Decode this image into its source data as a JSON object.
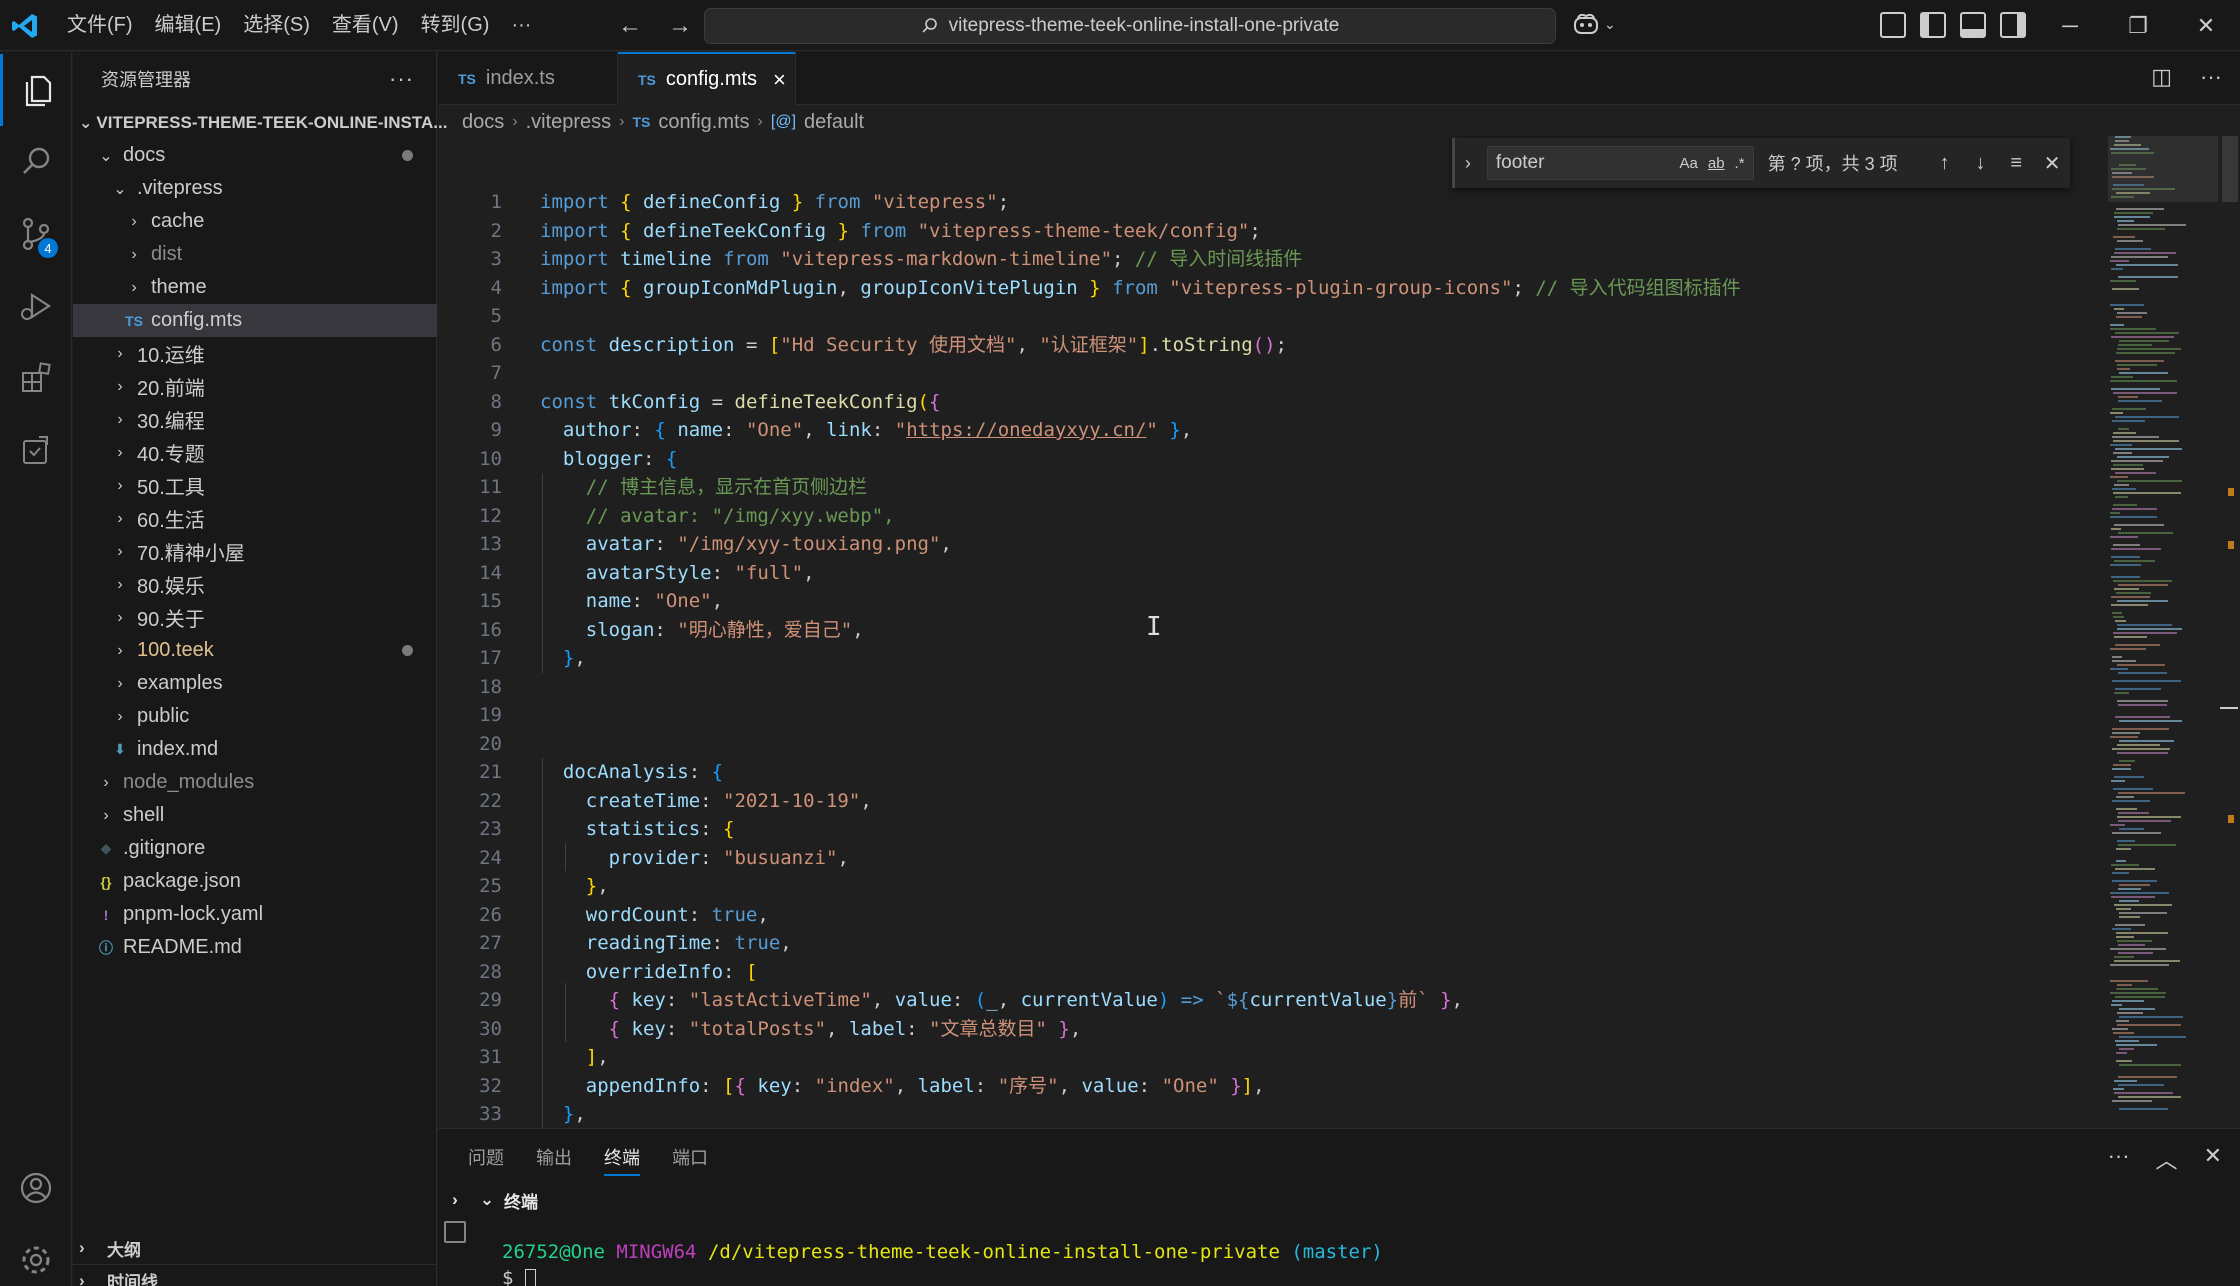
{
  "titlebar": {
    "menu": [
      "文件(F)",
      "编辑(E)",
      "选择(S)",
      "查看(V)",
      "转到(G)",
      "···"
    ],
    "search": "vitepress-theme-teek-online-install-one-private"
  },
  "activity": {
    "scm_badge": "4"
  },
  "sidebar": {
    "title": "资源管理器",
    "more": "···",
    "root": "VITEPRESS-THEME-TEEK-ONLINE-INSTA...",
    "tree": [
      {
        "label": "docs",
        "depth": 1,
        "type": "folder-open",
        "dot": true
      },
      {
        "label": ".vitepress",
        "depth": 2,
        "type": "folder-open"
      },
      {
        "label": "cache",
        "depth": 3,
        "type": "folder"
      },
      {
        "label": "dist",
        "depth": 3,
        "type": "folder",
        "dim": true
      },
      {
        "label": "theme",
        "depth": 3,
        "type": "folder"
      },
      {
        "label": "config.mts",
        "depth": 3,
        "type": "ts",
        "selected": true
      },
      {
        "label": "10.运维",
        "depth": 2,
        "type": "folder"
      },
      {
        "label": "20.前端",
        "depth": 2,
        "type": "folder"
      },
      {
        "label": "30.编程",
        "depth": 2,
        "type": "folder"
      },
      {
        "label": "40.专题",
        "depth": 2,
        "type": "folder"
      },
      {
        "label": "50.工具",
        "depth": 2,
        "type": "folder"
      },
      {
        "label": "60.生活",
        "depth": 2,
        "type": "folder"
      },
      {
        "label": "70.精神小屋",
        "depth": 2,
        "type": "folder"
      },
      {
        "label": "80.娱乐",
        "depth": 2,
        "type": "folder"
      },
      {
        "label": "90.关于",
        "depth": 2,
        "type": "folder"
      },
      {
        "label": "100.teek",
        "depth": 2,
        "type": "folder",
        "dot": true,
        "color": "#e2c08d"
      },
      {
        "label": "examples",
        "depth": 2,
        "type": "folder"
      },
      {
        "label": "public",
        "depth": 2,
        "type": "folder"
      },
      {
        "label": "index.md",
        "depth": 2,
        "type": "md"
      },
      {
        "label": "node_modules",
        "depth": 1,
        "type": "folder",
        "dim": true
      },
      {
        "label": "shell",
        "depth": 1,
        "type": "folder"
      },
      {
        "label": ".gitignore",
        "depth": 1,
        "type": "git"
      },
      {
        "label": "package.json",
        "depth": 1,
        "type": "json"
      },
      {
        "label": "pnpm-lock.yaml",
        "depth": 1,
        "type": "yaml"
      },
      {
        "label": "README.md",
        "depth": 1,
        "type": "info"
      }
    ],
    "outline": "大纲",
    "timeline": "时间线"
  },
  "tabs": [
    {
      "label": "index.ts",
      "lang": "TS",
      "active": false
    },
    {
      "label": "config.mts",
      "lang": "TS",
      "active": true
    }
  ],
  "breadcrumb": {
    "parts": [
      "docs",
      ".vitepress",
      "config.mts",
      "default"
    ],
    "ts": "TS",
    "sym": "[@]"
  },
  "find": {
    "query": "footer",
    "opts": [
      "Aa",
      "ab",
      ".*"
    ],
    "count": "第 ? 项，共 3 项"
  },
  "code": [
    {
      "n": "1",
      "seg": [
        [
          "k",
          "import"
        ],
        [
          "p",
          " "
        ],
        [
          "b1",
          "{"
        ],
        [
          "p",
          " "
        ],
        [
          "v",
          "defineConfig"
        ],
        [
          "p",
          " "
        ],
        [
          "b1",
          "}"
        ],
        [
          "p",
          " "
        ],
        [
          "k",
          "from"
        ],
        [
          "p",
          " "
        ],
        [
          "s",
          "\"vitepress\""
        ],
        [
          "p",
          ";"
        ]
      ]
    },
    {
      "n": "2",
      "seg": [
        [
          "k",
          "import"
        ],
        [
          "p",
          " "
        ],
        [
          "b1",
          "{"
        ],
        [
          "p",
          " "
        ],
        [
          "v",
          "defineTeekConfig"
        ],
        [
          "p",
          " "
        ],
        [
          "b1",
          "}"
        ],
        [
          "p",
          " "
        ],
        [
          "k",
          "from"
        ],
        [
          "p",
          " "
        ],
        [
          "s",
          "\"vitepress-theme-teek/config\""
        ],
        [
          "p",
          ";"
        ]
      ]
    },
    {
      "n": "3",
      "seg": [
        [
          "k",
          "import"
        ],
        [
          "p",
          " "
        ],
        [
          "v",
          "timeline"
        ],
        [
          "p",
          " "
        ],
        [
          "k",
          "from"
        ],
        [
          "p",
          " "
        ],
        [
          "s",
          "\"vitepress-markdown-timeline\""
        ],
        [
          "p",
          "; "
        ],
        [
          "c",
          "// 导入时间线插件"
        ]
      ]
    },
    {
      "n": "4",
      "seg": [
        [
          "k",
          "import"
        ],
        [
          "p",
          " "
        ],
        [
          "b1",
          "{"
        ],
        [
          "p",
          " "
        ],
        [
          "v",
          "groupIconMdPlugin"
        ],
        [
          "p",
          ", "
        ],
        [
          "v",
          "groupIconVitePlugin"
        ],
        [
          "p",
          " "
        ],
        [
          "b1",
          "}"
        ],
        [
          "p",
          " "
        ],
        [
          "k",
          "from"
        ],
        [
          "p",
          " "
        ],
        [
          "s",
          "\"vitepress-plugin-group-icons\""
        ],
        [
          "p",
          "; "
        ],
        [
          "c",
          "// 导入代码组图标插件"
        ]
      ]
    },
    {
      "n": "5",
      "seg": []
    },
    {
      "n": "6",
      "seg": [
        [
          "k",
          "const"
        ],
        [
          "p",
          " "
        ],
        [
          "v",
          "description"
        ],
        [
          "p",
          " = "
        ],
        [
          "b1",
          "["
        ],
        [
          "s",
          "\"Hd Security 使用文档\""
        ],
        [
          "p",
          ", "
        ],
        [
          "s",
          "\"认证框架\""
        ],
        [
          "b1",
          "]"
        ],
        [
          "p",
          "."
        ],
        [
          "f",
          "toString"
        ],
        [
          "b2",
          "()"
        ],
        [
          "p",
          ";"
        ]
      ]
    },
    {
      "n": "7",
      "seg": []
    },
    {
      "n": "8",
      "seg": [
        [
          "k",
          "const"
        ],
        [
          "p",
          " "
        ],
        [
          "v",
          "tkConfig"
        ],
        [
          "p",
          " = "
        ],
        [
          "f",
          "defineTeekConfig"
        ],
        [
          "b1",
          "("
        ],
        [
          "b2",
          "{"
        ]
      ]
    },
    {
      "n": "9",
      "seg": [
        [
          "p",
          "  "
        ],
        [
          "v",
          "author"
        ],
        [
          "p",
          ": "
        ],
        [
          "b3",
          "{"
        ],
        [
          "p",
          " "
        ],
        [
          "v",
          "name"
        ],
        [
          "p",
          ": "
        ],
        [
          "s",
          "\"One\""
        ],
        [
          "p",
          ", "
        ],
        [
          "v",
          "link"
        ],
        [
          "p",
          ": "
        ],
        [
          "s",
          "\""
        ],
        [
          "su",
          "https://onedayxyy.cn/"
        ],
        [
          "s",
          "\""
        ],
        [
          "p",
          " "
        ],
        [
          "b3",
          "}"
        ],
        [
          "p",
          ","
        ]
      ]
    },
    {
      "n": "10",
      "seg": [
        [
          "p",
          "  "
        ],
        [
          "v",
          "blogger"
        ],
        [
          "p",
          ": "
        ],
        [
          "b3",
          "{"
        ]
      ]
    },
    {
      "n": "11",
      "seg": [
        [
          "p",
          "    "
        ],
        [
          "c",
          "// 博主信息，显示在首页侧边栏"
        ]
      ]
    },
    {
      "n": "12",
      "seg": [
        [
          "p",
          "    "
        ],
        [
          "c",
          "// avatar: \"/img/xyy.webp\","
        ]
      ]
    },
    {
      "n": "13",
      "seg": [
        [
          "p",
          "    "
        ],
        [
          "v",
          "avatar"
        ],
        [
          "p",
          ": "
        ],
        [
          "s",
          "\"/img/xyy-touxiang.png\""
        ],
        [
          "p",
          ","
        ]
      ]
    },
    {
      "n": "14",
      "seg": [
        [
          "p",
          "    "
        ],
        [
          "v",
          "avatarStyle"
        ],
        [
          "p",
          ": "
        ],
        [
          "s",
          "\"full\""
        ],
        [
          "p",
          ","
        ]
      ]
    },
    {
      "n": "15",
      "seg": [
        [
          "p",
          "    "
        ],
        [
          "v",
          "name"
        ],
        [
          "p",
          ": "
        ],
        [
          "s",
          "\"One\""
        ],
        [
          "p",
          ","
        ]
      ]
    },
    {
      "n": "16",
      "seg": [
        [
          "p",
          "    "
        ],
        [
          "v",
          "slogan"
        ],
        [
          "p",
          ": "
        ],
        [
          "s",
          "\"明心静性，爱自己\""
        ],
        [
          "p",
          ","
        ]
      ]
    },
    {
      "n": "17",
      "seg": [
        [
          "p",
          "  "
        ],
        [
          "b3",
          "}"
        ],
        [
          "p",
          ","
        ]
      ]
    },
    {
      "n": "18",
      "seg": []
    },
    {
      "n": "19",
      "seg": []
    },
    {
      "n": "20",
      "seg": []
    },
    {
      "n": "21",
      "seg": [
        [
          "p",
          "  "
        ],
        [
          "v",
          "docAnalysis"
        ],
        [
          "p",
          ": "
        ],
        [
          "b3",
          "{"
        ]
      ]
    },
    {
      "n": "22",
      "seg": [
        [
          "p",
          "    "
        ],
        [
          "v",
          "createTime"
        ],
        [
          "p",
          ": "
        ],
        [
          "s",
          "\"2021-10-19\""
        ],
        [
          "p",
          ","
        ]
      ]
    },
    {
      "n": "23",
      "seg": [
        [
          "p",
          "    "
        ],
        [
          "v",
          "statistics"
        ],
        [
          "p",
          ": "
        ],
        [
          "b1",
          "{"
        ]
      ]
    },
    {
      "n": "24",
      "seg": [
        [
          "p",
          "      "
        ],
        [
          "v",
          "provider"
        ],
        [
          "p",
          ": "
        ],
        [
          "s",
          "\"busuanzi\""
        ],
        [
          "p",
          ","
        ]
      ]
    },
    {
      "n": "25",
      "seg": [
        [
          "p",
          "    "
        ],
        [
          "b1",
          "}"
        ],
        [
          "p",
          ","
        ]
      ]
    },
    {
      "n": "26",
      "seg": [
        [
          "p",
          "    "
        ],
        [
          "v",
          "wordCount"
        ],
        [
          "p",
          ": "
        ],
        [
          "k",
          "true"
        ],
        [
          "p",
          ","
        ]
      ]
    },
    {
      "n": "27",
      "seg": [
        [
          "p",
          "    "
        ],
        [
          "v",
          "readingTime"
        ],
        [
          "p",
          ": "
        ],
        [
          "k",
          "true"
        ],
        [
          "p",
          ","
        ]
      ]
    },
    {
      "n": "28",
      "seg": [
        [
          "p",
          "    "
        ],
        [
          "v",
          "overrideInfo"
        ],
        [
          "p",
          ": "
        ],
        [
          "b1",
          "["
        ]
      ]
    },
    {
      "n": "29",
      "seg": [
        [
          "p",
          "      "
        ],
        [
          "b2",
          "{"
        ],
        [
          "p",
          " "
        ],
        [
          "v",
          "key"
        ],
        [
          "p",
          ": "
        ],
        [
          "s",
          "\"lastActiveTime\""
        ],
        [
          "p",
          ", "
        ],
        [
          "v",
          "value"
        ],
        [
          "p",
          ": "
        ],
        [
          "b3",
          "("
        ],
        [
          "v",
          "_"
        ],
        [
          "p",
          ", "
        ],
        [
          "v",
          "currentValue"
        ],
        [
          "b3",
          ")"
        ],
        [
          "p",
          " "
        ],
        [
          "k",
          "=>"
        ],
        [
          "p",
          " "
        ],
        [
          "s",
          "`"
        ],
        [
          "k",
          "${"
        ],
        [
          "v",
          "currentValue"
        ],
        [
          "k",
          "}"
        ],
        [
          "s",
          "前`"
        ],
        [
          "p",
          " "
        ],
        [
          "b2",
          "}"
        ],
        [
          "p",
          ","
        ]
      ]
    },
    {
      "n": "30",
      "seg": [
        [
          "p",
          "      "
        ],
        [
          "b2",
          "{"
        ],
        [
          "p",
          " "
        ],
        [
          "v",
          "key"
        ],
        [
          "p",
          ": "
        ],
        [
          "s",
          "\"totalPosts\""
        ],
        [
          "p",
          ", "
        ],
        [
          "v",
          "label"
        ],
        [
          "p",
          ": "
        ],
        [
          "s",
          "\"文章总数目\""
        ],
        [
          "p",
          " "
        ],
        [
          "b2",
          "}"
        ],
        [
          "p",
          ","
        ]
      ]
    },
    {
      "n": "31",
      "seg": [
        [
          "p",
          "    "
        ],
        [
          "b1",
          "]"
        ],
        [
          "p",
          ","
        ]
      ]
    },
    {
      "n": "32",
      "seg": [
        [
          "p",
          "    "
        ],
        [
          "v",
          "appendInfo"
        ],
        [
          "p",
          ": "
        ],
        [
          "b1",
          "["
        ],
        [
          "b2",
          "{"
        ],
        [
          "p",
          " "
        ],
        [
          "v",
          "key"
        ],
        [
          "p",
          ": "
        ],
        [
          "s",
          "\"index\""
        ],
        [
          "p",
          ", "
        ],
        [
          "v",
          "label"
        ],
        [
          "p",
          ": "
        ],
        [
          "s",
          "\"序号\""
        ],
        [
          "p",
          ", "
        ],
        [
          "v",
          "value"
        ],
        [
          "p",
          ": "
        ],
        [
          "s",
          "\"One\""
        ],
        [
          "p",
          " "
        ],
        [
          "b2",
          "}"
        ],
        [
          "b1",
          "]"
        ],
        [
          "p",
          ","
        ]
      ]
    },
    {
      "n": "33",
      "seg": [
        [
          "p",
          "  "
        ],
        [
          "b3",
          "}"
        ],
        [
          "p",
          ","
        ]
      ]
    }
  ],
  "panel": {
    "tabs": [
      "问题",
      "输出",
      "终端",
      "端口"
    ],
    "active_tab": "终端",
    "terminal_title": "终端",
    "prompt_user": "26752@One",
    "prompt_env": "MINGW64",
    "prompt_path": "/d/vitepress-theme-teek-online-install-one-private",
    "prompt_branch": "(master)",
    "prompt_symbol": "$"
  },
  "colors": {
    "accent": "#0078d4",
    "editor_bg": "#1f1f1f",
    "chrome_bg": "#181818"
  }
}
